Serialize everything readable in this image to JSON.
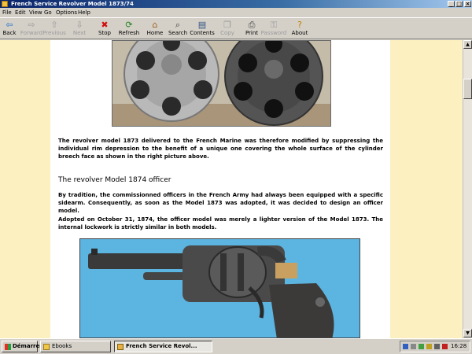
{
  "window": {
    "title": "French Service Revolver Model 1873/74"
  },
  "menu": [
    "File",
    "Edit",
    "View",
    "Go",
    "Options",
    "Help"
  ],
  "toolbar": [
    {
      "label": "Back",
      "icon": "back-arrow-icon",
      "glyph": "⇦",
      "color": "#1e6ec8",
      "enabled": true
    },
    {
      "label": "Forward",
      "icon": "forward-arrow-icon",
      "glyph": "⇨",
      "color": "#9a9a9a",
      "enabled": false
    },
    {
      "label": "Previous",
      "icon": "up-arrow-icon",
      "glyph": "⇧",
      "color": "#9a9a9a",
      "enabled": false
    },
    {
      "label": "Next",
      "icon": "down-arrow-icon",
      "glyph": "⇩",
      "color": "#9a9a9a",
      "enabled": false
    },
    {
      "label": "Stop",
      "icon": "stop-icon",
      "glyph": "✖",
      "color": "#d01010",
      "enabled": true
    },
    {
      "label": "Refresh",
      "icon": "refresh-icon",
      "glyph": "⟳",
      "color": "#208020",
      "enabled": true
    },
    {
      "label": "Home",
      "icon": "home-icon",
      "glyph": "⌂",
      "color": "#a06020",
      "enabled": true
    },
    {
      "label": "Search",
      "icon": "search-icon",
      "glyph": "⌕",
      "color": "#404040",
      "enabled": true
    },
    {
      "label": "Contents",
      "icon": "contents-icon",
      "glyph": "▤",
      "color": "#305080",
      "enabled": true
    },
    {
      "label": "Copy",
      "icon": "copy-icon",
      "glyph": "❐",
      "color": "#9a9a9a",
      "enabled": false
    },
    {
      "label": "Print",
      "icon": "print-icon",
      "glyph": "⎙",
      "color": "#404040",
      "enabled": true
    },
    {
      "label": "Password",
      "icon": "password-icon",
      "glyph": "⚿",
      "color": "#9a9a9a",
      "enabled": false
    },
    {
      "label": "About",
      "icon": "about-icon",
      "glyph": "?",
      "color": "#c08000",
      "enabled": true
    }
  ],
  "content": {
    "para1": "The revolver model 1873 delivered to the French Marine was therefore modified by suppressing the individual rim depression to the benefit of a unique one covering the whole surface of the cylinder breech face as shown in the right picture above.",
    "heading": "The revolver Model 1874 officer",
    "para2": "By tradition, the commissionned officers in the French Army had always been equipped with a specific sidearm. Consequently, as soon as the Model 1873 was adopted, it was decided to design an officer model.",
    "para3": "Adopted on October 31, 1874, the officer model was merely a lighter version of the Model 1873. The internal lockwork is strictly similar in both models."
  },
  "taskbar": {
    "start_label": "Démarrer",
    "tasks": [
      {
        "label": "Ebooks",
        "active": false
      },
      {
        "label": "French Service Revol...",
        "active": true
      }
    ],
    "clock": "16:28"
  },
  "colors": {
    "page_background": "#fcefc0",
    "title_bar": "#0a246a"
  }
}
